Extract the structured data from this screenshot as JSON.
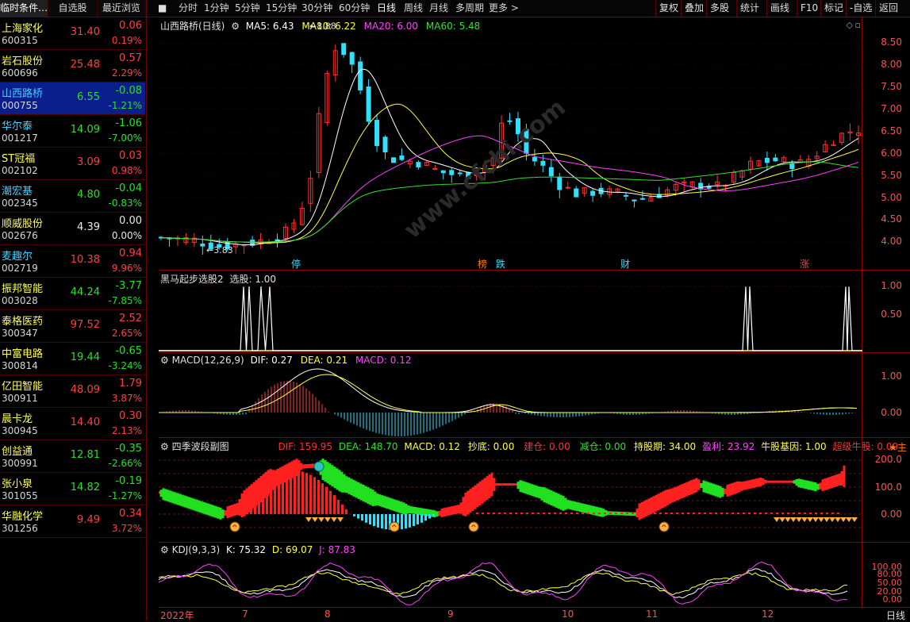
{
  "watchlist": {
    "tabs": [
      "临时条件…",
      "自选股",
      "最近浏览"
    ],
    "rows": [
      {
        "name": "上海家化",
        "code": "600315",
        "price": "31.40",
        "chg": "0.06",
        "pct": "0.19%",
        "dir": "up"
      },
      {
        "name": "岩石股份",
        "code": "600696",
        "price": "25.48",
        "chg": "0.57",
        "pct": "2.29%",
        "dir": "up"
      },
      {
        "name": "山西路桥",
        "code": "000755",
        "price": "6.55",
        "chg": "-0.08",
        "pct": "-1.21%",
        "dir": "dn"
      },
      {
        "name": "华尔泰",
        "code": "001217",
        "price": "14.09",
        "chg": "-1.06",
        "pct": "-7.00%",
        "dir": "dn"
      },
      {
        "name": "ST冠福",
        "code": "002102",
        "price": "3.09",
        "chg": "0.03",
        "pct": "0.98%",
        "dir": "up"
      },
      {
        "name": "潮宏基",
        "code": "002345",
        "price": "4.80",
        "chg": "-0.04",
        "pct": "-0.83%",
        "dir": "dn"
      },
      {
        "name": "顺威股份",
        "code": "002676",
        "price": "4.39",
        "chg": "0.00",
        "pct": "0.00%",
        "dir": "fl"
      },
      {
        "name": "麦趣尔",
        "code": "002719",
        "price": "10.38",
        "chg": "0.94",
        "pct": "9.96%",
        "dir": "up"
      },
      {
        "name": "振邦智能",
        "code": "003028",
        "price": "44.24",
        "chg": "-3.77",
        "pct": "-7.85%",
        "dir": "dn"
      },
      {
        "name": "泰格医药",
        "code": "300347",
        "price": "97.52",
        "chg": "2.52",
        "pct": "2.65%",
        "dir": "up"
      },
      {
        "name": "中富电路",
        "code": "300814",
        "price": "19.44",
        "chg": "-0.65",
        "pct": "-3.24%",
        "dir": "dn"
      },
      {
        "name": "亿田智能",
        "code": "300911",
        "price": "48.09",
        "chg": "1.79",
        "pct": "3.87%",
        "dir": "up"
      },
      {
        "name": "晨卡龙",
        "code": "300945",
        "price": "14.40",
        "chg": "0.30",
        "pct": "2.13%",
        "dir": "up"
      },
      {
        "name": "创益通",
        "code": "300991",
        "price": "12.81",
        "chg": "-0.35",
        "pct": "-2.66%",
        "dir": "dn"
      },
      {
        "name": "张小泉",
        "code": "301055",
        "price": "14.82",
        "chg": "-0.19",
        "pct": "-1.27%",
        "dir": "dn"
      },
      {
        "name": "华融化学",
        "code": "301256",
        "price": "9.49",
        "chg": "0.34",
        "pct": "3.72%",
        "dir": "up"
      }
    ]
  },
  "toolbar": {
    "periods": [
      "分时",
      "1分钟",
      "5分钟",
      "15分钟",
      "30分钟",
      "60分钟",
      "日线",
      "周线",
      "月线",
      "多周期",
      "更多 >"
    ],
    "active": "日线",
    "right": [
      "复权",
      "叠加",
      "多股",
      "统计",
      "画线",
      "F10",
      "标记",
      "-自选",
      "返回"
    ]
  },
  "main_panel": {
    "title": "山西路桥(日线)",
    "ma5": "MA5: 6.43",
    "ma10": "MA10: 6.22",
    "ma20": "MA20: 6.00",
    "ma60": "MA60: 5.48",
    "high_label": "8.88",
    "low_label": "3.83",
    "y_ticks": [
      "8.50",
      "8.00",
      "7.50",
      "7.00",
      "6.50",
      "6.00",
      "5.50",
      "5.00",
      "4.50",
      "4.00"
    ],
    "markers": [
      "停",
      "榜",
      "跌",
      "财",
      "涨"
    ]
  },
  "panel2": {
    "title": "黑马起步选股2",
    "value": "选股: 1.00",
    "y_ticks": [
      "1.00",
      "0.50",
      "0.00"
    ]
  },
  "panel3": {
    "title": "MACD(12,26,9)",
    "dif": "DIF: 0.27",
    "dea": "DEA: 0.21",
    "macd": "MACD: 0.12",
    "y_ticks": [
      "1.00",
      "0.00"
    ]
  },
  "panel4": {
    "title": "四季波段副图",
    "dif": "DIF: 159.95",
    "dea": "DEA: 148.70",
    "macd": "MACD: 0.12",
    "chaodi": "抄底: 0.00",
    "jiancang": "建仓: 0.00",
    "jiancang2": "减仓: 0.00",
    "chigu": "持股期: 34.00",
    "yingli": "盈利: 23.92",
    "niugu": "牛股基因: 1.00",
    "chaoji": "超级牛股: 0.00",
    "main": "★主",
    "y_ticks": [
      "200.0",
      "100.0",
      "0.00"
    ]
  },
  "panel5": {
    "title": "KDJ(9,3,3)",
    "k": "K: 75.32",
    "d": "D: 69.07",
    "j": "J: 87.83",
    "y_ticks": [
      "100.00",
      "80.00",
      "50.00",
      "20.00",
      "0.00"
    ]
  },
  "x_axis": {
    "labels": [
      "2022年",
      "7",
      "8",
      "9",
      "10",
      "11",
      "12"
    ],
    "right": "日线"
  },
  "colors": {
    "up": "#ff3030",
    "down": "#30e0ff",
    "ma5": "#ffffff",
    "ma10": "#ffff40",
    "ma20": "#ff40ff",
    "ma60": "#30e030"
  }
}
